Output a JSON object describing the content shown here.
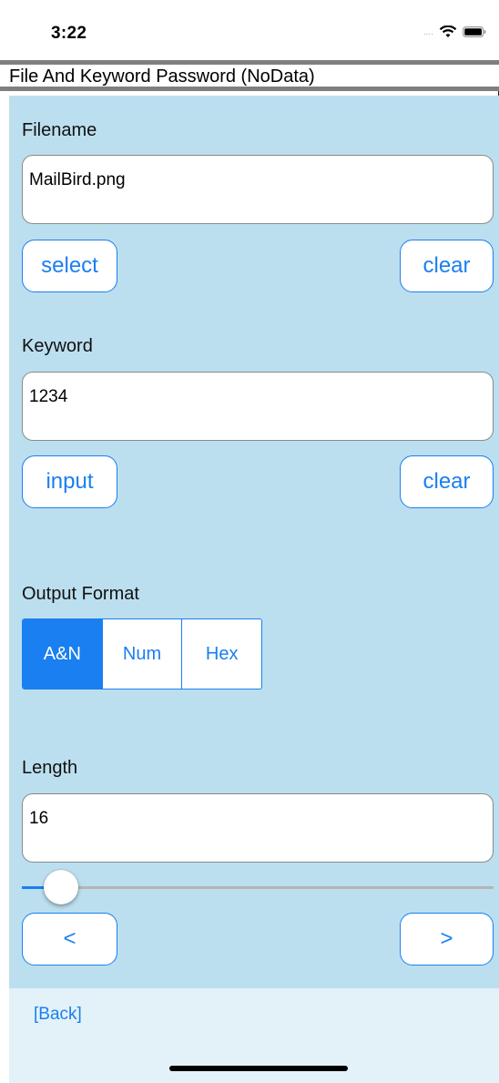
{
  "status_bar": {
    "time": "3:22",
    "signal": "....",
    "wifi_icon": "wifi-icon",
    "battery_icon": "battery-icon"
  },
  "title": "File And Keyword Password (NoData)",
  "filename": {
    "label": "Filename",
    "value": "MailBird.png",
    "select_label": "select",
    "clear_label": "clear"
  },
  "keyword": {
    "label": "Keyword",
    "value": "1234",
    "input_label": "input",
    "clear_label": "clear"
  },
  "output_format": {
    "label": "Output Format",
    "options": [
      "A&N",
      "Num",
      "Hex"
    ],
    "selected": "A&N"
  },
  "length": {
    "label": "Length",
    "value": "16",
    "slider_fraction": 0.06,
    "prev_label": "<",
    "next_label": ">"
  },
  "back_label": "[Back]",
  "colors": {
    "accent": "#1a7ff0",
    "content_bg": "#bcdfef",
    "bottom_bg": "#e3f2f8",
    "rule": "#7f7f7f"
  }
}
